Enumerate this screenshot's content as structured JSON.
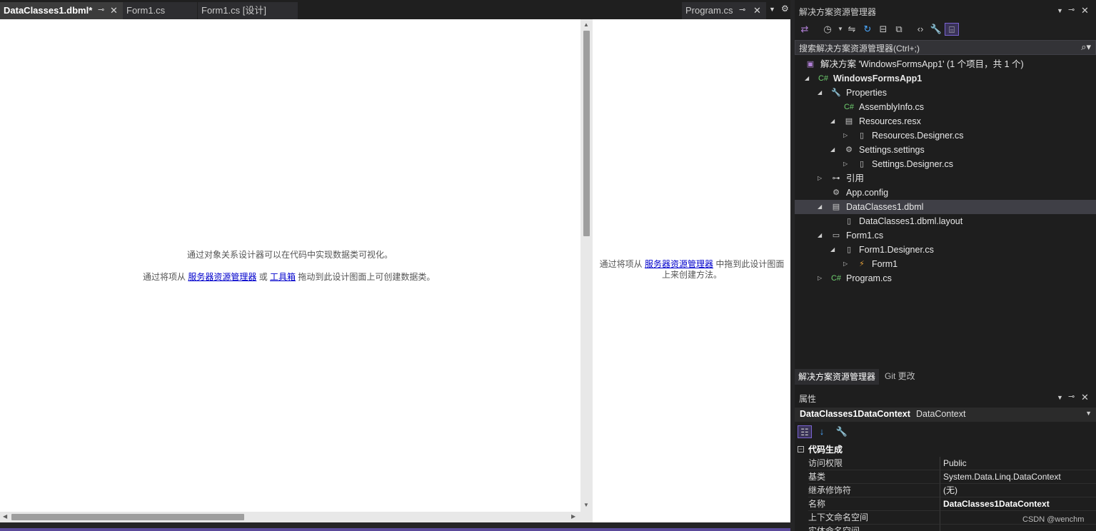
{
  "document_tabs": [
    {
      "label": "DataClasses1.dbml*",
      "active": true
    },
    {
      "label": "Form1.cs",
      "active": false
    },
    {
      "label": "Form1.cs [设计]",
      "active": false
    }
  ],
  "side_tab": {
    "label": "Program.cs"
  },
  "designer": {
    "hint_line1": "通过对象关系设计器可以在代码中实现数据类可视化。",
    "hint2_prefix": "通过将项从 ",
    "hint2_link1": "服务器资源管理器",
    "hint2_or": " 或 ",
    "hint2_link2": "工具箱",
    "hint2_suffix": " 拖动到此设计图面上可创建数据类。"
  },
  "methods_pane": {
    "prefix": "通过将项从 ",
    "link": "服务器资源管理器",
    "suffix": " 中拖到此设计图面上来创建方法。"
  },
  "solution_explorer": {
    "title": "解决方案资源管理器",
    "search_placeholder": "搜索解决方案资源管理器(Ctrl+;)",
    "tree": [
      {
        "label": "解决方案 'WindowsFormsApp1' (1 个项目，共 1 个)",
        "icon": "solution-icon",
        "glyph": "▣",
        "color": "#b180d7"
      },
      {
        "label": "WindowsFormsApp1",
        "icon": "csharp-project-icon",
        "glyph": "C#",
        "color": "#6fcf6f",
        "expander": "◢",
        "bold": true
      },
      {
        "label": "Properties",
        "icon": "wrench-icon",
        "glyph": "🔧",
        "color": "#c8c8c8",
        "expander": "◢"
      },
      {
        "label": "AssemblyInfo.cs",
        "icon": "csharp-file-icon",
        "glyph": "C#",
        "color": "#6fcf6f"
      },
      {
        "label": "Resources.resx",
        "icon": "resource-file-icon",
        "glyph": "▤",
        "color": "#c8c8c8",
        "expander": "◢"
      },
      {
        "label": "Resources.Designer.cs",
        "icon": "file-icon",
        "glyph": "▯",
        "color": "#c8c8c8",
        "expander": "▷"
      },
      {
        "label": "Settings.settings",
        "icon": "gear-icon",
        "glyph": "⚙",
        "color": "#c8c8c8",
        "expander": "◢"
      },
      {
        "label": "Settings.Designer.cs",
        "icon": "file-icon",
        "glyph": "▯",
        "color": "#c8c8c8",
        "expander": "▷"
      },
      {
        "label": "引用",
        "icon": "references-icon",
        "glyph": "⊶",
        "color": "#c8c8c8",
        "expander": "▷"
      },
      {
        "label": "App.config",
        "icon": "config-icon",
        "glyph": "⚙",
        "color": "#c8c8c8"
      },
      {
        "label": "DataClasses1.dbml",
        "icon": "dbml-icon",
        "glyph": "▤",
        "color": "#c8c8c8",
        "expander": "◢",
        "selected": true
      },
      {
        "label": "DataClasses1.dbml.layout",
        "icon": "file-icon",
        "glyph": "▯",
        "color": "#c8c8c8"
      },
      {
        "label": "Form1.cs",
        "icon": "form-icon",
        "glyph": "▭",
        "color": "#c8c8c8",
        "expander": "◢"
      },
      {
        "label": "Form1.Designer.cs",
        "icon": "file-icon",
        "glyph": "▯",
        "color": "#c8c8c8",
        "expander": "◢"
      },
      {
        "label": "Form1",
        "icon": "class-icon",
        "glyph": "⚡",
        "color": "#e8a33c",
        "expander": "▷"
      },
      {
        "label": "Program.cs",
        "icon": "csharp-file-icon",
        "glyph": "C#",
        "color": "#6fcf6f",
        "expander": "▷"
      }
    ],
    "bottom_tabs": [
      {
        "label": "解决方案资源管理器",
        "active": true
      },
      {
        "label": "Git 更改",
        "active": false
      }
    ]
  },
  "properties": {
    "title": "属性",
    "object_name": "DataClasses1DataContext",
    "object_type": "DataContext",
    "category": "代码生成",
    "rows": [
      {
        "key": "访问权限",
        "value": "Public",
        "bold": false
      },
      {
        "key": "基类",
        "value": "System.Data.Linq.DataContext",
        "bold": false
      },
      {
        "key": "继承修饰符",
        "value": "(无)",
        "bold": false
      },
      {
        "key": "名称",
        "value": "DataClasses1DataContext",
        "bold": true
      },
      {
        "key": "上下文命名空间",
        "value": "",
        "bold": false
      },
      {
        "key": "实体命名空间",
        "value": "",
        "bold": false
      }
    ]
  },
  "watermark": "CSDN @wenchm",
  "colors": {
    "accent": "#7a63d2",
    "link": "#0000cc",
    "csharp": "#6fcf6f"
  }
}
